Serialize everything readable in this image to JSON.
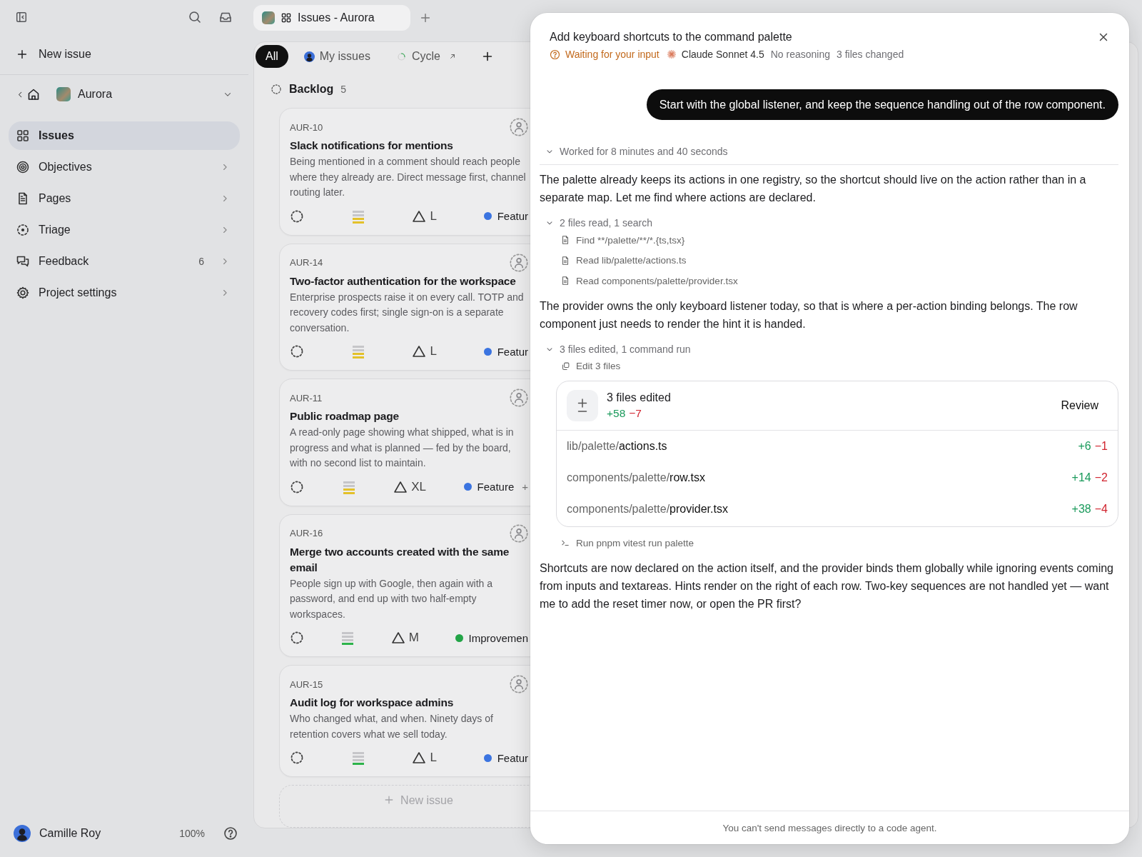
{
  "topbar": {
    "tabs": [
      {
        "label": "Issues - Aurora",
        "selected": true
      }
    ]
  },
  "sidebar": {
    "new_issue": "New issue",
    "project": "Aurora",
    "nav": [
      {
        "label": "Issues",
        "selected": true
      },
      {
        "label": "Objectives",
        "selected": false
      },
      {
        "label": "Pages",
        "selected": false
      },
      {
        "label": "Triage",
        "selected": false
      },
      {
        "label": "Feedback",
        "selected": false,
        "count": "6"
      },
      {
        "label": "Project settings",
        "selected": false
      }
    ],
    "user": {
      "name": "Camille Roy",
      "zoom": "100%"
    }
  },
  "board": {
    "filters": [
      {
        "label": "All",
        "selected": true
      },
      {
        "label": "My issues",
        "selected": false
      },
      {
        "label": "Cycle",
        "selected": false
      }
    ],
    "column": {
      "title": "Backlog",
      "count": "5"
    },
    "cards": [
      {
        "id": "AUR-10",
        "title": "Slack notifications for mentions",
        "description": "Being mentioned in a comment should reach people where they already are. Direct message first, channel routing later.",
        "priority": {
          "level": 0.5,
          "color": "#e3c12a"
        },
        "estimate": "L",
        "label": {
          "name": "Featur",
          "color": "#3b74e0"
        }
      },
      {
        "id": "AUR-14",
        "title": "Two-factor authentication for the workspace",
        "description": "Enterprise prospects raise it on every call. TOTP and recovery codes first; single sign-on is a separate conversation.",
        "priority": {
          "level": 0.5,
          "color": "#e3c12a"
        },
        "estimate": "L",
        "label": {
          "name": "Featur",
          "color": "#3b74e0"
        }
      },
      {
        "id": "AUR-11",
        "title": "Public roadmap page",
        "description": "A read-only page showing what shipped, what is in progress and what is planned — fed by the board, with no second list to maintain.",
        "priority": {
          "level": 0.5,
          "color": "#e3c12a"
        },
        "estimate": "XL",
        "label": {
          "name": "Feature",
          "color": "#3b74e0"
        },
        "more": "+"
      },
      {
        "id": "AUR-16",
        "title": "Merge two accounts created with the same email",
        "description": "People sign up with Google, then again with a password, and end up with two half-empty workspaces.",
        "priority": {
          "level": 0.25,
          "color": "#2db34a"
        },
        "estimate": "M",
        "label": {
          "name": "Improvemen",
          "color": "#22a447"
        }
      },
      {
        "id": "AUR-15",
        "title": "Audit log for workspace admins",
        "description": "Who changed what, and when. Ninety days of retention covers what we sell today.",
        "priority": {
          "level": 0.25,
          "color": "#2db34a"
        },
        "estimate": "L",
        "label": {
          "name": "Featur",
          "color": "#3b74e0"
        }
      }
    ],
    "new_issue": "New issue"
  },
  "agent_panel": {
    "title": "Add keyboard shortcuts to the command palette",
    "status": "Waiting for your input",
    "model": "Claude Sonnet 4.5",
    "reasoning": "No reasoning",
    "changes": "3 files changed",
    "user_message": "Start with the global listener, and keep the sequence handling out of the row component.",
    "transcript": [
      {
        "kind": "summary",
        "text": "Worked for 8 minutes and 40 seconds",
        "expanded": true
      },
      {
        "kind": "text",
        "text": "The palette already keeps its actions in one registry, so the shortcut should live on the action rather than in a separate map. Let me find where actions are declared."
      },
      {
        "kind": "group",
        "text": "2 files read, 1 search",
        "expanded": true,
        "items": [
          {
            "kind": "file",
            "text": "Find **/palette/**/*.{ts,tsx}"
          },
          {
            "kind": "file",
            "text": "Read lib/palette/actions.ts"
          },
          {
            "kind": "file",
            "text": "Read components/palette/provider.tsx"
          }
        ]
      },
      {
        "kind": "text",
        "text": "The provider owns the only keyboard listener today, so that is where a per-action binding belongs. The row component just needs to render the hint it is handed."
      },
      {
        "kind": "group",
        "text": "3 files edited, 1 command run",
        "expanded": true,
        "items": [
          {
            "kind": "edit",
            "text": "Edit 3 files"
          },
          {
            "kind": "diff",
            "title": "3 files edited",
            "additions": "+58",
            "deletions": "−7",
            "action": "Review",
            "files": [
              {
                "path": "lib/palette/**actions.ts**",
                "additions": "+6",
                "deletions": "−1"
              },
              {
                "path": "components/palette/**row.tsx**",
                "additions": "+14",
                "deletions": "−2"
              },
              {
                "path": "components/palette/**provider.tsx**",
                "additions": "+38",
                "deletions": "−4"
              }
            ]
          },
          {
            "kind": "command",
            "text": "Run pnpm vitest run palette"
          }
        ]
      },
      {
        "kind": "text",
        "text": "Shortcuts are now declared on the action itself, and the provider binds them globally while ignoring events coming from inputs and textareas. Hints render on the right of each row. Two-key sequences are not handled yet — want me to add the reset timer now, or open the PR first?"
      }
    ],
    "footer": "You can't send messages directly to a code agent."
  }
}
